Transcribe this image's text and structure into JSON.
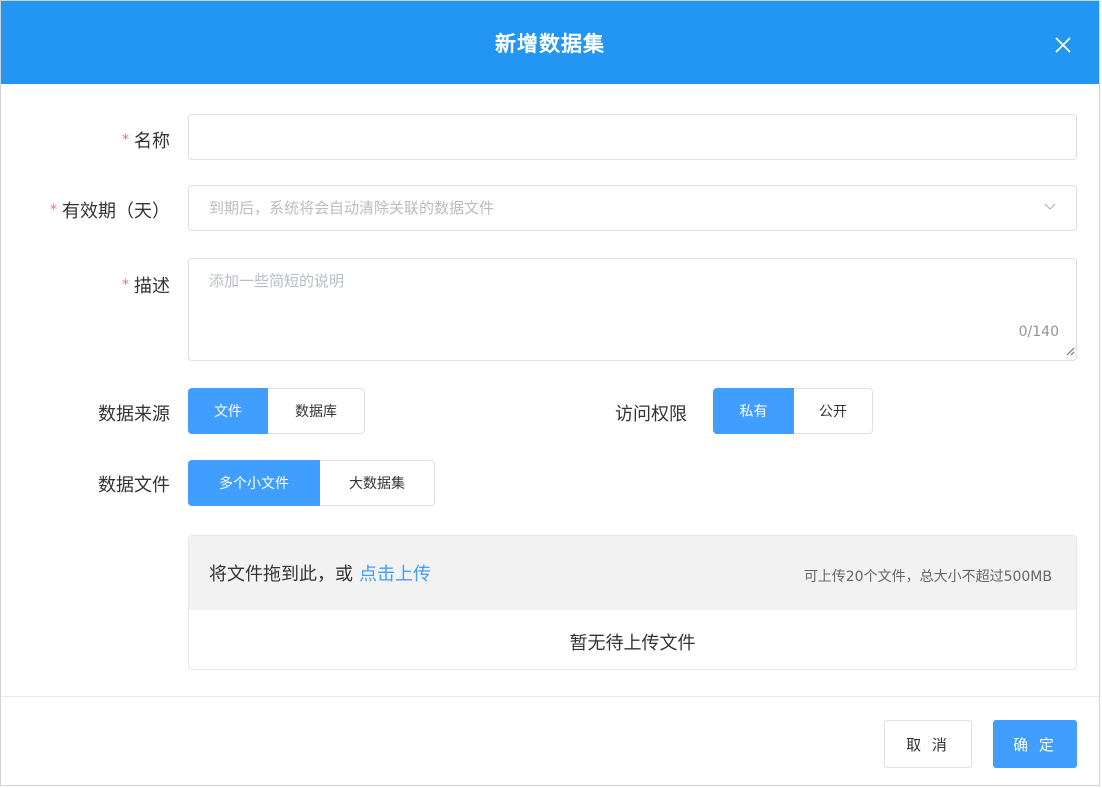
{
  "dialog": {
    "title": "新增数据集"
  },
  "form": {
    "name": {
      "label": "名称",
      "required_mark": "*",
      "value": "",
      "placeholder": ""
    },
    "validity": {
      "label": "有效期（天）",
      "required_mark": "*",
      "value": "",
      "placeholder": "到期后，系统将会自动清除关联的数据文件"
    },
    "description": {
      "label": "描述",
      "required_mark": "*",
      "value": "",
      "placeholder": "添加一些简短的说明",
      "counter": "0/140"
    },
    "data_source": {
      "label": "数据来源",
      "options": [
        "文件",
        "数据库"
      ],
      "selected": "文件"
    },
    "access": {
      "label": "访问权限",
      "options": [
        "私有",
        "公开"
      ],
      "selected": "私有"
    },
    "data_file": {
      "label": "数据文件",
      "options": [
        "多个小文件",
        "大数据集"
      ],
      "selected": "多个小文件"
    }
  },
  "upload": {
    "drop_text": "将文件拖到此，或",
    "link_text": "点击上传",
    "limit_text": "可上传20个文件，总大小不超过500MB",
    "empty_text": "暂无待上传文件"
  },
  "footer": {
    "cancel_label": "取 消",
    "ok_label": "确 定"
  },
  "colors": {
    "header": "#2396f3",
    "primary": "#409eff",
    "required": "#f56c6c"
  },
  "icons": {
    "close": "close-icon",
    "caret": "chevron-down-icon",
    "resize": "resize-grip-icon"
  }
}
